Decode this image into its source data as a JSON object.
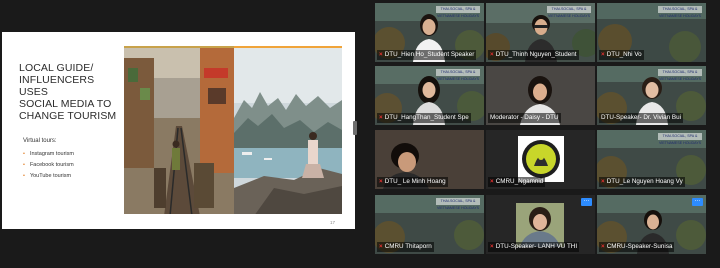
{
  "slide": {
    "title_lines": [
      "LOCAL GUIDE/",
      "INFLUENCERS USES",
      "SOCIAL MEDIA TO",
      "CHANGE TOURISM"
    ],
    "subhead": "Virtual tours:",
    "items": [
      "Instagram tourism",
      "Facebook tourism",
      "YouTube tourism"
    ],
    "page_number": "17"
  },
  "participants": [
    {
      "name": "DTU_Hien Ho_Student Speaker",
      "muted": true
    },
    {
      "name": "DTU_Thinh Nguyen_Student",
      "muted": true
    },
    {
      "name": "DTU_Nhi Vo",
      "muted": true
    },
    {
      "name": "DTU_HangThan_Student Spe",
      "muted": true
    },
    {
      "name": "Moderator - Daisy - DTU",
      "muted": false
    },
    {
      "name": "DTU-Speaker- Dr. Vivian Bui",
      "muted": false,
      "active": true
    },
    {
      "name": "DTU_ Le Minh Hoang",
      "muted": true
    },
    {
      "name": "CMRU_Ngamnid",
      "muted": true
    },
    {
      "name": "DTU_Le Nguyen Hoang Vy",
      "muted": true
    },
    {
      "name": "CMRU Thitaporn",
      "muted": true
    },
    {
      "name": "DTU-Speaker- LANH VU THI",
      "muted": true
    },
    {
      "name": "CMRU-Speaker-Sunisa",
      "muted": true
    }
  ],
  "badge_text": "THAI-SOCIAL, SPA & VIETNAMESE HOLIDAYS",
  "colors": {
    "meeting_background": "#1a1a1a",
    "active_speaker": "#9bd21e",
    "muted_icon": "#e5312f",
    "options_button": "#2d8cff",
    "slide_bullet": "#e07a1f"
  },
  "icons": {
    "mic": "mic-off-icon",
    "options": "more-options-icon"
  }
}
